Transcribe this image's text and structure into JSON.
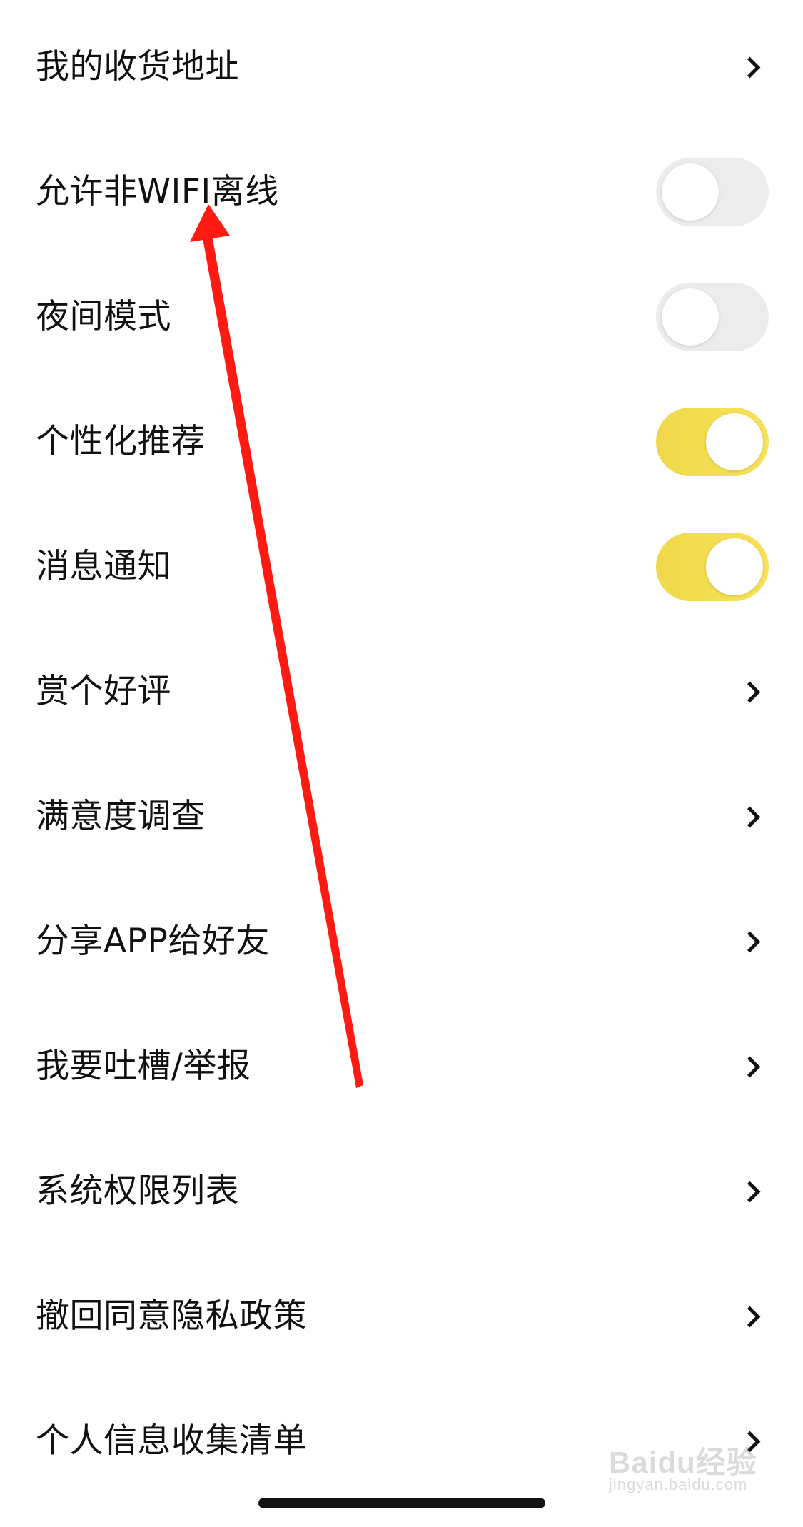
{
  "settings": {
    "items": [
      {
        "label": "我的收货地址",
        "control": "chevron"
      },
      {
        "label": "允许非WIFI离线",
        "control": "toggle",
        "on": false
      },
      {
        "label": "夜间模式",
        "control": "toggle",
        "on": false
      },
      {
        "label": "个性化推荐",
        "control": "toggle",
        "on": true
      },
      {
        "label": "消息通知",
        "control": "toggle",
        "on": true
      },
      {
        "label": "赏个好评",
        "control": "chevron"
      },
      {
        "label": "满意度调查",
        "control": "chevron"
      },
      {
        "label": "分享APP给好友",
        "control": "chevron"
      },
      {
        "label": "我要吐槽/举报",
        "control": "chevron"
      },
      {
        "label": "系统权限列表",
        "control": "chevron"
      },
      {
        "label": "撤回同意隐私政策",
        "control": "chevron"
      },
      {
        "label": "个人信息收集清单",
        "control": "chevron"
      }
    ]
  },
  "colors": {
    "toggle_on": "#f2dc4e",
    "toggle_off": "#ececec",
    "arrow": "#ff1a12"
  },
  "watermark": {
    "line1": "Baidu经验",
    "line2": "jingyan.baidu.com"
  }
}
